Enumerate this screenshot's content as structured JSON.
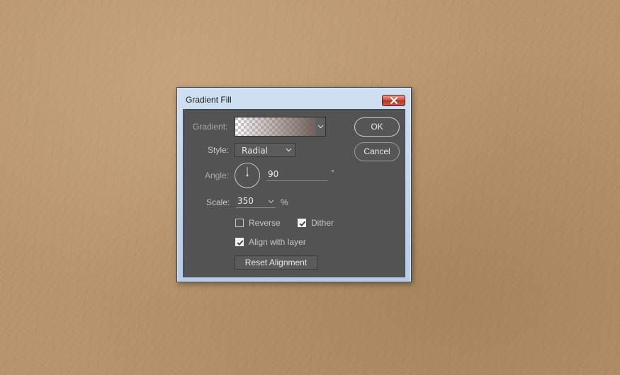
{
  "dialog": {
    "title": "Gradient Fill",
    "gradient_label": "Gradient:",
    "style_label": "Style:",
    "style_value": "Radial",
    "angle_label": "Angle:",
    "angle_value": "90",
    "angle_unit": "°",
    "scale_label": "Scale:",
    "scale_value": "350",
    "scale_unit": "%",
    "reverse_label": "Reverse",
    "reverse_checked": false,
    "dither_label": "Dither",
    "dither_checked": true,
    "align_label": "Align with layer",
    "align_checked": true,
    "reset_label": "Reset Alignment",
    "ok_label": "OK",
    "cancel_label": "Cancel"
  },
  "icons": {
    "close": "close-icon",
    "gradient_dropdown": "chevron-down-icon",
    "style_dropdown": "chevron-down-icon",
    "scale_dropdown": "chevron-down-icon",
    "angle_dial": "angle-dial-icon",
    "checkmark": "check-icon"
  },
  "colors": {
    "dialog_bg": "#535353",
    "frame": "#c4d7ec",
    "close_button": "#c7493a",
    "background_leather": "#b8946c"
  }
}
